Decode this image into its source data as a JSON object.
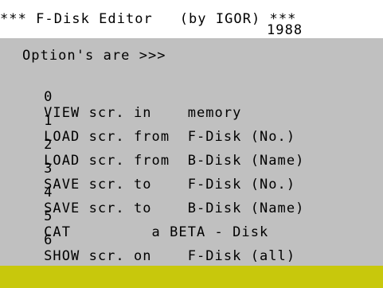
{
  "header": {
    "title_line": "*** F-Disk Editor   (by IGOR) ***",
    "year": "1988"
  },
  "menu": {
    "prompt": "Option's are >>>",
    "items": [
      {
        "key": "0",
        "text": "VIEW scr. in    memory"
      },
      {
        "key": "1",
        "text": "LOAD scr. from  F-Disk (No.)"
      },
      {
        "key": "2",
        "text": "LOAD scr. from  B-Disk (Name)"
      },
      {
        "key": "3",
        "text": "SAVE scr. to    F-Disk (No.)"
      },
      {
        "key": "4",
        "text": "SAVE scr. to    B-Disk (Name)"
      },
      {
        "key": "5",
        "text": "CAT         a BETA - Disk"
      },
      {
        "key": "6",
        "text": "SHOW scr. on    F-Disk (all)"
      }
    ]
  },
  "colors": {
    "screen_bg": "#c0c0c0",
    "title_bg": "#ffffff",
    "status_bar": "#c8c80c",
    "text": "#000000"
  }
}
